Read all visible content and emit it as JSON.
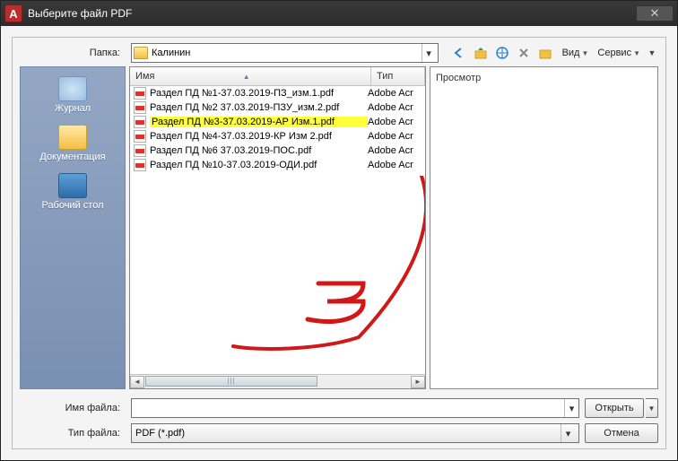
{
  "titlebar": {
    "title": "Выберите файл PDF"
  },
  "folder_row": {
    "label": "Папка:",
    "folder_name": "Калинин",
    "menu_view": "Вид",
    "menu_tools": "Сервис"
  },
  "sidebar": {
    "items": [
      {
        "label": "Журнал"
      },
      {
        "label": "Документация"
      },
      {
        "label": "Рабочий стол"
      }
    ]
  },
  "columns": {
    "name": "Имя",
    "type": "Тип"
  },
  "files": [
    {
      "name": "Раздел ПД №1-37.03.2019-ПЗ_изм.1.pdf",
      "type": "Adobe Acr",
      "highlighted": false
    },
    {
      "name": "Раздел ПД №2 37.03.2019-ПЗУ_изм.2.pdf",
      "type": "Adobe Acr",
      "highlighted": false
    },
    {
      "name": "Раздел ПД №3-37.03.2019-АР Изм.1.pdf",
      "type": "Adobe Acr",
      "highlighted": true
    },
    {
      "name": "Раздел ПД №4-37.03.2019-КР Изм 2.pdf",
      "type": "Adobe Acr",
      "highlighted": false
    },
    {
      "name": "Раздел ПД №6 37.03.2019-ПОС.pdf",
      "type": "Adobe Acr",
      "highlighted": false
    },
    {
      "name": "Раздел ПД №10-37.03.2019-ОДИ.pdf",
      "type": "Adobe Acr",
      "highlighted": false
    }
  ],
  "preview": {
    "label": "Просмотр"
  },
  "filename_row": {
    "label": "Имя файла:",
    "value": ""
  },
  "filetype_row": {
    "label": "Тип файла:",
    "value": "PDF (*.pdf)"
  },
  "buttons": {
    "open": "Открыть",
    "cancel": "Отмена"
  }
}
